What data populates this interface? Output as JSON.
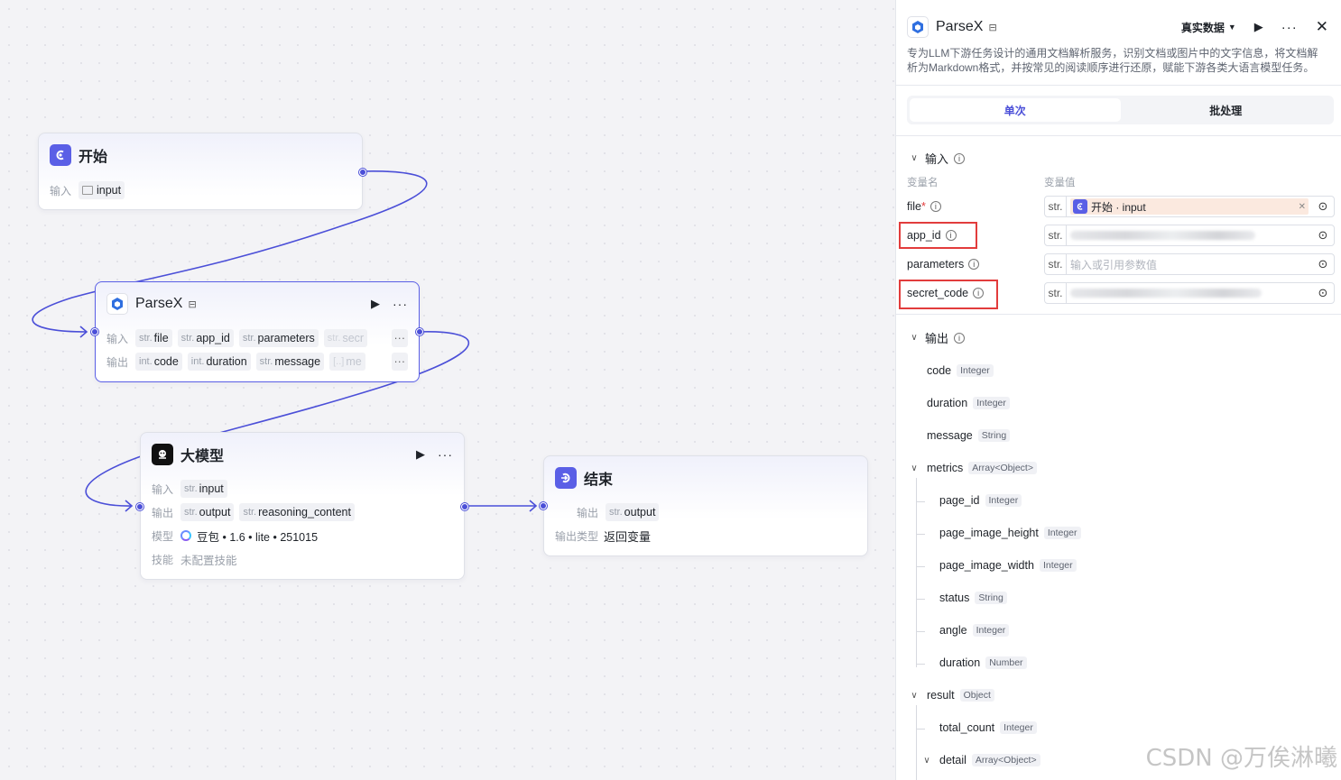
{
  "canvas": {
    "start_node": {
      "title": "开始",
      "input_label": "输入",
      "inputs": [
        {
          "name": "input"
        }
      ]
    },
    "parsex_node": {
      "title": "ParseX",
      "input_label": "输入",
      "output_label": "输出",
      "inputs": [
        {
          "type": "str.",
          "name": "file"
        },
        {
          "type": "str.",
          "name": "app_id"
        },
        {
          "type": "str.",
          "name": "parameters"
        },
        {
          "type": "str.",
          "name": "secr"
        }
      ],
      "outputs": [
        {
          "type": "int.",
          "name": "code"
        },
        {
          "type": "int.",
          "name": "duration"
        },
        {
          "type": "str.",
          "name": "message"
        },
        {
          "type": "[..]",
          "name": "me"
        }
      ],
      "more": "···"
    },
    "llm_node": {
      "title": "大模型",
      "input_label": "输入",
      "output_label": "输出",
      "model_label": "模型",
      "skill_label": "技能",
      "inputs": [
        {
          "type": "str.",
          "name": "input"
        }
      ],
      "outputs": [
        {
          "type": "str.",
          "name": "output"
        },
        {
          "type": "str.",
          "name": "reasoning_content"
        }
      ],
      "model_value": "豆包 • 1.6 • lite • 251015",
      "skill_value": "未配置技能"
    },
    "end_node": {
      "title": "结束",
      "output_label": "输出",
      "outputs": [
        {
          "type": "str.",
          "name": "output"
        }
      ],
      "output_type_label": "输出类型",
      "output_type_value": "返回变量"
    }
  },
  "panel": {
    "title": "ParseX",
    "data_mode": "真实数据",
    "description": "专为LLM下游任务设计的通用文档解析服务，识别文档或图片中的文字信息，将文档解析为Markdown格式，并按常见的阅读顺序进行还原，赋能下游各类大语言模型任务。",
    "tabs": {
      "single": "单次",
      "batch": "批处理"
    },
    "inputs_section": {
      "title": "输入",
      "col_name": "变量名",
      "col_value": "变量值",
      "params": [
        {
          "name": "file",
          "required": "*",
          "type": "str.",
          "ref": "开始 · input"
        },
        {
          "name": "app_id",
          "type": "str."
        },
        {
          "name": "parameters",
          "type": "str.",
          "placeholder": "输入或引用参数值"
        },
        {
          "name": "secret_code",
          "type": "str."
        }
      ]
    },
    "outputs_section": {
      "title": "输出",
      "items": [
        {
          "name": "code",
          "type": "Integer"
        },
        {
          "name": "duration",
          "type": "Integer"
        },
        {
          "name": "message",
          "type": "String"
        },
        {
          "name": "metrics",
          "type": "Array<Object>"
        },
        {
          "name": "page_id",
          "type": "Integer"
        },
        {
          "name": "page_image_height",
          "type": "Integer"
        },
        {
          "name": "page_image_width",
          "type": "Integer"
        },
        {
          "name": "status",
          "type": "String"
        },
        {
          "name": "angle",
          "type": "Integer"
        },
        {
          "name": "duration",
          "type": "Number"
        },
        {
          "name": "result",
          "type": "Object"
        },
        {
          "name": "total_count",
          "type": "Integer"
        },
        {
          "name": "detail",
          "type": "Array<Object>"
        }
      ]
    }
  },
  "watermark": "CSDN @万俟淋曦",
  "colors": {
    "accent": "#4b4fd8",
    "highlight": "#e23c3c",
    "ref_bg": "#fbe9df"
  }
}
